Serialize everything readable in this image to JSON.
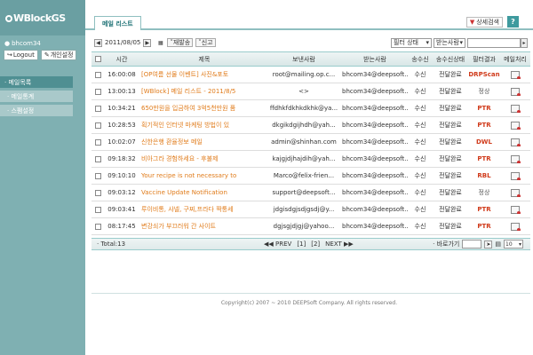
{
  "app": {
    "logo": "WBlockGS"
  },
  "user": {
    "name": "bhcom34"
  },
  "buttons": {
    "logout": "Logout",
    "settings": "개인설정"
  },
  "sidebar": {
    "items": [
      {
        "label": "· 메일목록"
      },
      {
        "label": "· 메일통계"
      },
      {
        "label": "· 스팸설정"
      }
    ]
  },
  "tabs": {
    "mail_list": "메일 리스트"
  },
  "detail_search": "상세검색",
  "help": "?",
  "toolbar": {
    "date": "2011/08/05",
    "resend": "재발송",
    "report": "신고",
    "filter_select": "필터 상태",
    "recipient_select": "받는사람"
  },
  "table": {
    "headers": [
      "시간",
      "제목",
      "보낸사람",
      "받는사람",
      "송수신",
      "송수신상태",
      "필터결과",
      "메일처리"
    ],
    "rows": [
      {
        "time": "16:00:08",
        "subject": "[OP여름 선물 이벤트] 사진&포토",
        "sender": "root@mailing.op.c...",
        "recipient": "bhcom34@deepsoft...",
        "direction": "수신",
        "status": "전달완료",
        "filter": "DRPScan"
      },
      {
        "time": "13:00:13",
        "subject": "[WBlock] 메일 리스트 - 2011/8/5",
        "sender": "<>",
        "recipient": "bhcom34@deepsoft...",
        "direction": "수신",
        "status": "전달완료",
        "filter": "정상"
      },
      {
        "time": "10:34:21",
        "subject": "650만원을 입금하여 3억5천만원 품",
        "sender": "ffdhkfdkhkdkhk@ya...",
        "recipient": "bhcom34@deepsoft...",
        "direction": "수신",
        "status": "전달완료",
        "filter": "PTR"
      },
      {
        "time": "10:28:53",
        "subject": "획기적인 인터넷 마케팅 방법이 있",
        "sender": "dkgikdgijhdh@yah...",
        "recipient": "bhcom34@deepsoft...",
        "direction": "수신",
        "status": "전달완료",
        "filter": "PTR"
      },
      {
        "time": "10:02:07",
        "subject": "신한은행 환율정보 메일",
        "sender": "admin@shinhan.com",
        "recipient": "bhcom34@deepsoft...",
        "direction": "수신",
        "status": "전달완료",
        "filter": "DWL"
      },
      {
        "time": "09:18:32",
        "subject": "비아그라 경험하세요 - 후불제",
        "sender": "kajgjdjhajdih@yah...",
        "recipient": "bhcom34@deepsoft...",
        "direction": "수신",
        "status": "전달완료",
        "filter": "PTR"
      },
      {
        "time": "09:10:10",
        "subject": "Your recipe is not necessary to",
        "sender": "Marco@felix-frien...",
        "recipient": "bhcom34@deepsoft...",
        "direction": "수신",
        "status": "전달완료",
        "filter": "RBL"
      },
      {
        "time": "09:03:12",
        "subject": "Vaccine Update Notification",
        "sender": "support@deepsoft...",
        "recipient": "bhcom34@deepsoft...",
        "direction": "수신",
        "status": "전달완료",
        "filter": "정상"
      },
      {
        "time": "09:03:41",
        "subject": "루이비통, 샤넬, 구찌,프라다 짝퉁세",
        "sender": "jdgisdgjsdjgsdj@y...",
        "recipient": "bhcom34@deepsoft...",
        "direction": "수신",
        "status": "전달완료",
        "filter": "PTR"
      },
      {
        "time": "08:17:45",
        "subject": "변강쇠가 부끄러워 간 사이트",
        "sender": "dgjsgjdjgj@yahoo...",
        "recipient": "bhcom34@deepsoft...",
        "direction": "수신",
        "status": "전달완료",
        "filter": "PTR"
      }
    ]
  },
  "pager": {
    "total": "· Total:13",
    "prev": "PREV",
    "pages": [
      "[1]",
      "[2]"
    ],
    "next": "NEXT",
    "goto_label": "· 바로가기",
    "page_size": "10"
  },
  "footer": {
    "copyright": "Copyright(c) 2007 ~ 2010 DEEPSoft Company.  All rights reserved."
  },
  "colors": {
    "sidebar": "#7fb0b2",
    "accent": "#3e9a9e",
    "subject": "#e07b1a",
    "filter": "#d03a1a"
  }
}
